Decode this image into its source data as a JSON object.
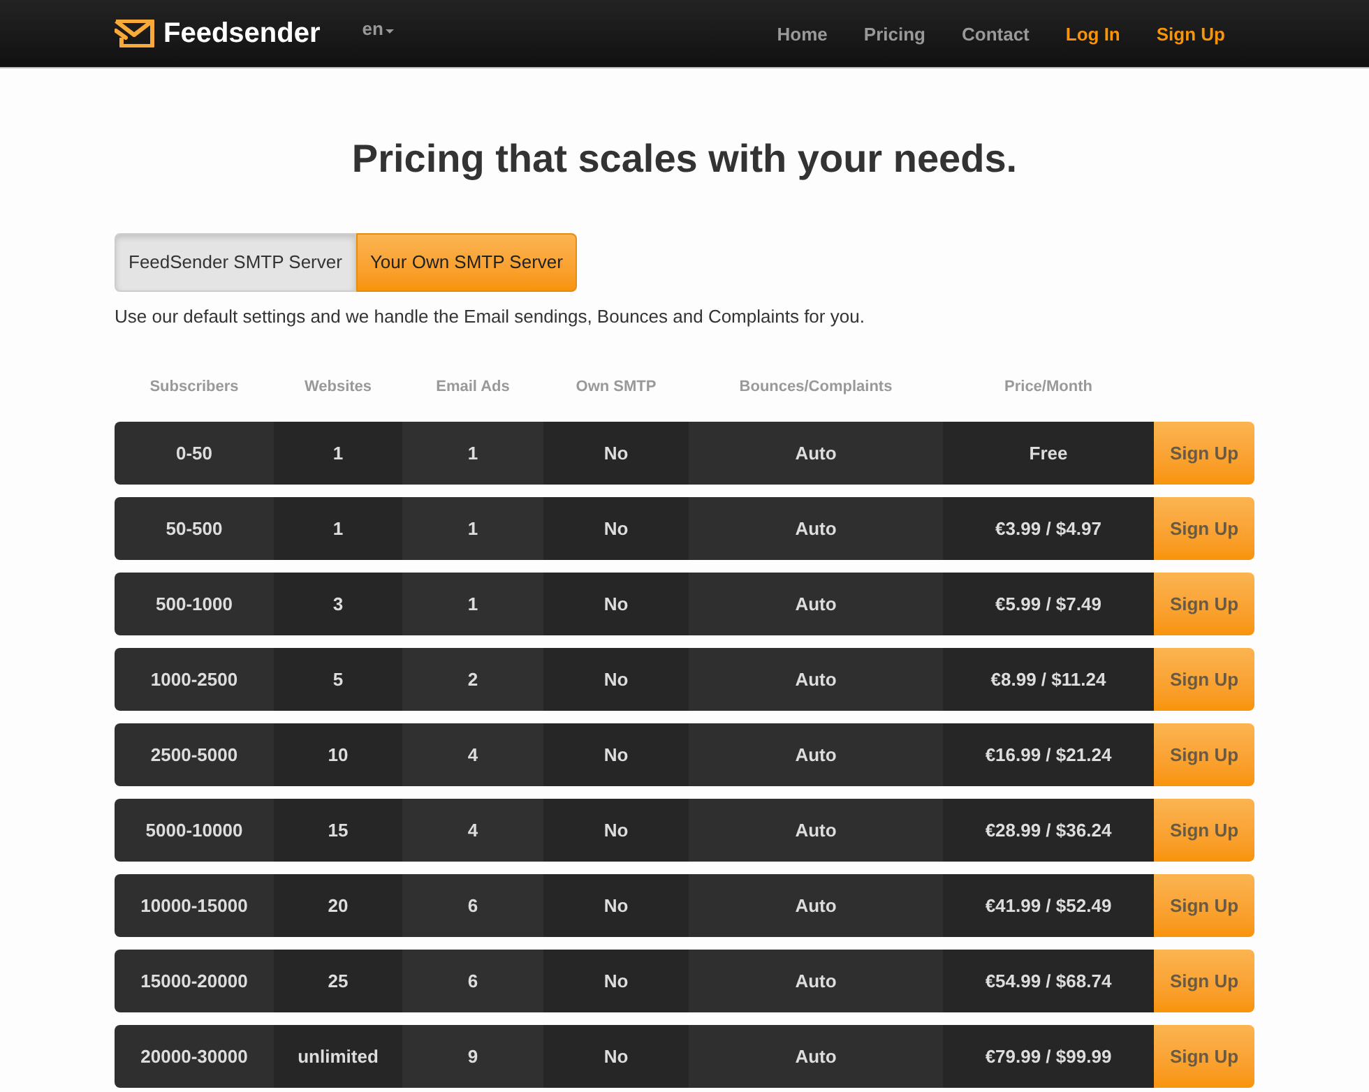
{
  "navbar": {
    "brand": "Feedsender",
    "language": "en",
    "links": [
      {
        "label": "Home",
        "kind": "link"
      },
      {
        "label": "Pricing",
        "kind": "link"
      },
      {
        "label": "Contact",
        "kind": "link"
      },
      {
        "label": "Log In",
        "kind": "cta"
      },
      {
        "label": "Sign Up",
        "kind": "cta"
      }
    ]
  },
  "heading": "Pricing that scales with your needs.",
  "server_toggle": [
    {
      "label": "FeedSender SMTP Server",
      "selected": true
    },
    {
      "label": "Your Own SMTP Server",
      "selected": false
    }
  ],
  "description": "Use our default settings and we handle the Email sendings, Bounces and Complaints for you.",
  "table": {
    "columns": [
      "Subscribers",
      "Websites",
      "Email Ads",
      "Own SMTP",
      "Bounces/Complaints",
      "Price/Month"
    ],
    "rows": [
      {
        "cells": [
          "0-50",
          "1",
          "1",
          "No",
          "Auto",
          "Free"
        ],
        "action": "Sign Up"
      },
      {
        "cells": [
          "50-500",
          "1",
          "1",
          "No",
          "Auto",
          "€3.99 / $4.97"
        ],
        "action": "Sign Up"
      },
      {
        "cells": [
          "500-1000",
          "3",
          "1",
          "No",
          "Auto",
          "€5.99 / $7.49"
        ],
        "action": "Sign Up"
      },
      {
        "cells": [
          "1000-2500",
          "5",
          "2",
          "No",
          "Auto",
          "€8.99 / $11.24"
        ],
        "action": "Sign Up"
      },
      {
        "cells": [
          "2500-5000",
          "10",
          "4",
          "No",
          "Auto",
          "€16.99 / $21.24"
        ],
        "action": "Sign Up"
      },
      {
        "cells": [
          "5000-10000",
          "15",
          "4",
          "No",
          "Auto",
          "€28.99 / $36.24"
        ],
        "action": "Sign Up"
      },
      {
        "cells": [
          "10000-15000",
          "20",
          "6",
          "No",
          "Auto",
          "€41.99 / $52.49"
        ],
        "action": "Sign Up"
      },
      {
        "cells": [
          "15000-20000",
          "25",
          "6",
          "No",
          "Auto",
          "€54.99 / $68.74"
        ],
        "action": "Sign Up"
      },
      {
        "cells": [
          "20000-30000",
          "unlimited",
          "9",
          "No",
          "Auto",
          "€79.99 / $99.99"
        ],
        "action": "Sign Up"
      }
    ]
  }
}
